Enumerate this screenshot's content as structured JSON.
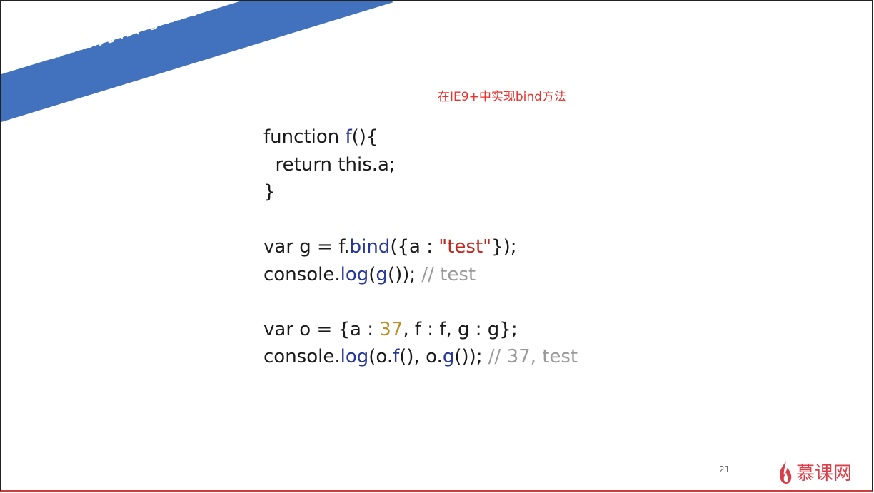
{
  "slide": {
    "banner_title": "bind方法与this",
    "subtitle": "在IE9+中实现bind方法",
    "page_number": "21",
    "logo_text": "慕课网"
  },
  "code": {
    "lines": [
      [
        {
          "t": "function ",
          "c": "plain"
        },
        {
          "t": "f",
          "c": "fn"
        },
        {
          "t": "(){",
          "c": "plain"
        }
      ],
      [
        {
          "t": "  return this.a;",
          "c": "plain"
        }
      ],
      [
        {
          "t": "}",
          "c": "plain"
        }
      ],
      [],
      [
        {
          "t": "var g = f.",
          "c": "plain"
        },
        {
          "t": "bind",
          "c": "fn"
        },
        {
          "t": "({a : ",
          "c": "plain"
        },
        {
          "t": "\"test\"",
          "c": "str"
        },
        {
          "t": "});",
          "c": "plain"
        }
      ],
      [
        {
          "t": "console.",
          "c": "plain"
        },
        {
          "t": "log",
          "c": "fn"
        },
        {
          "t": "(",
          "c": "plain"
        },
        {
          "t": "g",
          "c": "fn"
        },
        {
          "t": "()); ",
          "c": "plain"
        },
        {
          "t": "// test",
          "c": "comment"
        }
      ],
      [],
      [
        {
          "t": "var o = {a : ",
          "c": "plain"
        },
        {
          "t": "37",
          "c": "num"
        },
        {
          "t": ", f : f, g : g};",
          "c": "plain"
        }
      ],
      [
        {
          "t": "console.",
          "c": "plain"
        },
        {
          "t": "log",
          "c": "fn"
        },
        {
          "t": "(o.",
          "c": "plain"
        },
        {
          "t": "f",
          "c": "fn"
        },
        {
          "t": "(), o.",
          "c": "plain"
        },
        {
          "t": "g",
          "c": "fn"
        },
        {
          "t": "()); ",
          "c": "plain"
        },
        {
          "t": "// 37, test",
          "c": "comment"
        }
      ]
    ]
  },
  "colors": {
    "banner": "#4272bd",
    "subtitle": "#e8312c",
    "function": "#27389a",
    "string": "#c0291f",
    "number": "#b8902a",
    "comment": "#9a9a9a",
    "logo": "#d6404a"
  },
  "icons": {
    "logo": "flame-icon"
  }
}
